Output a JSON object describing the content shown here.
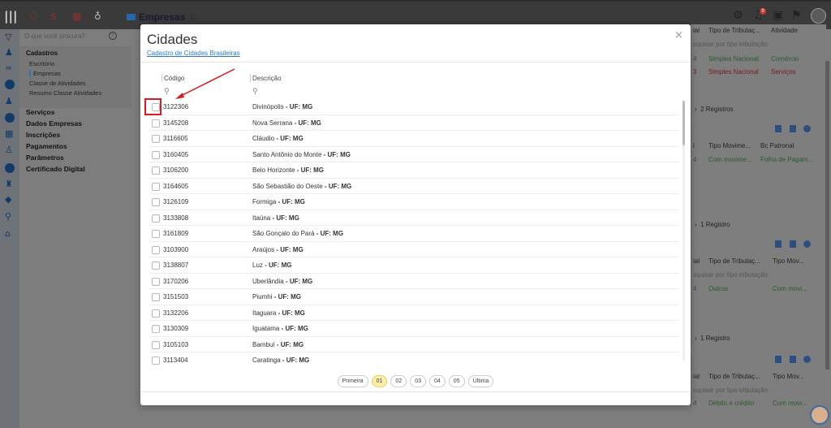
{
  "app": {
    "title": "Empresas",
    "title_info_icon": "info-icon",
    "logo": "|||",
    "search_placeholder": "O que você procura?",
    "help": "?",
    "notification_count": "9"
  },
  "sidebar": {
    "section_title": "Cadastros",
    "subitems": [
      "Escritório",
      "Empresas",
      "Classe de Atividades",
      "Resumo Classe Atividades"
    ],
    "selected_subitem": "Empresas",
    "nav": [
      "Serviços",
      "Dados Empresas",
      "Inscrições",
      "Pagamentos",
      "Parâmetros",
      "Certificado Digital"
    ]
  },
  "background_cards": {
    "card1": {
      "headers": [
        "ial",
        "Tipo de Tributaç...",
        "Atividade"
      ],
      "filter": "squisar por tipo tributação",
      "row1": [
        "4",
        "Simples Nacional",
        "Comércio"
      ],
      "row2": [
        "3",
        "Simples Nacional",
        "Serviços"
      ],
      "footer": "2 Registros"
    },
    "card2": {
      "headers": [
        "l",
        "Tipo Movime...",
        "Bc Patronal"
      ],
      "row1": [
        "4",
        "Com movime...",
        "Folha de Pagam..."
      ],
      "footer": "1 Registro"
    },
    "card3": {
      "headers": [
        "ial",
        "Tipo de Tributaç...",
        "Tipo Mov..."
      ],
      "filter": "squisar por tipo tributação",
      "row1": [
        "4",
        "Outros",
        "Com movi..."
      ],
      "footer": "1 Registro"
    },
    "card4": {
      "headers": [
        "ial",
        "Tipo de Tributaç...",
        "Tipo Mov..."
      ],
      "filter": "squisar por tipo tributação",
      "row1": [
        "4",
        "Débito e crédito",
        "Com movi..."
      ]
    }
  },
  "modal": {
    "title": "Cidades",
    "link": "Cadastro de Cidades Brasileiras",
    "close": "×",
    "col_code": "Código",
    "col_desc": "Descrição",
    "uf_label": " - UF: MG",
    "rows": [
      {
        "code": "3122306",
        "name": "Divinópolis"
      },
      {
        "code": "3145208",
        "name": "Nova Serrana"
      },
      {
        "code": "3116605",
        "name": "Cláudio"
      },
      {
        "code": "3160405",
        "name": "Santo Antônio do Monte"
      },
      {
        "code": "3106200",
        "name": "Belo Horizonte"
      },
      {
        "code": "3164605",
        "name": "São Sebastião do Oeste"
      },
      {
        "code": "3126109",
        "name": "Formiga"
      },
      {
        "code": "3133808",
        "name": "Itaúna"
      },
      {
        "code": "3161809",
        "name": "São Gonçalo do Pará"
      },
      {
        "code": "3103900",
        "name": "Araújos"
      },
      {
        "code": "3138807",
        "name": "Luz"
      },
      {
        "code": "3170206",
        "name": "Uberlândia"
      },
      {
        "code": "3151503",
        "name": "Piumhi"
      },
      {
        "code": "3132206",
        "name": "Itaguara"
      },
      {
        "code": "3130309",
        "name": "Iguatama"
      },
      {
        "code": "3105103",
        "name": "Bambuí"
      },
      {
        "code": "3113404",
        "name": "Caratinga"
      }
    ],
    "pager": {
      "first": "Primeira",
      "pages": [
        "01",
        "02",
        "03",
        "04",
        "05"
      ],
      "current": "01",
      "last": "Última"
    }
  }
}
